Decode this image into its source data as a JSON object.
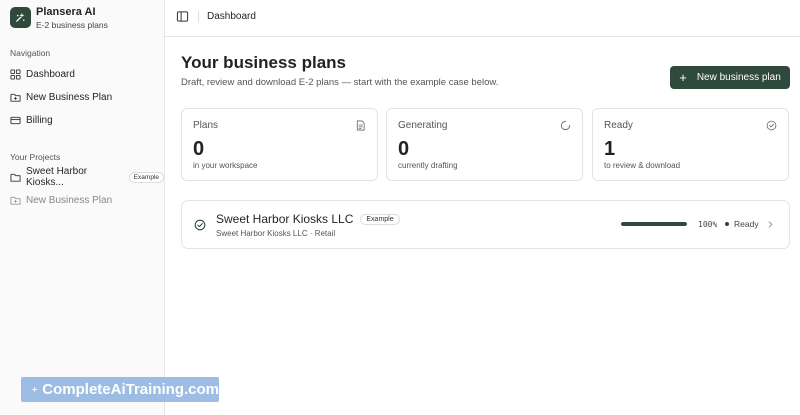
{
  "brand": {
    "name": "Plansera AI",
    "subtitle": "E-2 business plans"
  },
  "sidebar": {
    "nav_label": "Navigation",
    "nav_items": [
      {
        "label": "Dashboard",
        "icon": "dashboard-icon"
      },
      {
        "label": "New Business Plan",
        "icon": "folder-plus-icon"
      },
      {
        "label": "Billing",
        "icon": "credit-card-icon"
      }
    ],
    "projects_label": "Your Projects",
    "projects": [
      {
        "label": "Sweet Harbor Kiosks...",
        "badge": "Example",
        "icon": "folder-icon"
      },
      {
        "label": "New Business Plan",
        "icon": "folder-plus-icon"
      }
    ]
  },
  "topbar": {
    "title": "Dashboard",
    "toggle_icon": "sidebar-toggle-icon"
  },
  "main": {
    "title": "Your business plans",
    "subtitle": "Draft, review and download E-2 plans — start with the example case below.",
    "new_button": "New business plan",
    "stats": [
      {
        "label": "Plans",
        "value": "0",
        "caption": "in your workspace",
        "icon": "document-icon"
      },
      {
        "label": "Generating",
        "value": "0",
        "caption": "currently drafting",
        "icon": "spinner-icon"
      },
      {
        "label": "Ready",
        "value": "1",
        "caption": "to review & download",
        "icon": "check-circle-icon"
      }
    ],
    "project": {
      "title": "Sweet Harbor Kiosks LLC",
      "badge": "Example",
      "subtitle": "Sweet Harbor Kiosks LLC · Retail",
      "progress": 1.0,
      "percent_label": "100%",
      "status": "Ready"
    }
  },
  "watermark": {
    "text": "CompleteAiTraining.com"
  },
  "colors": {
    "accent": "#2f4a3c",
    "border": "#e3e3e3",
    "watermark": "#82aadc"
  }
}
